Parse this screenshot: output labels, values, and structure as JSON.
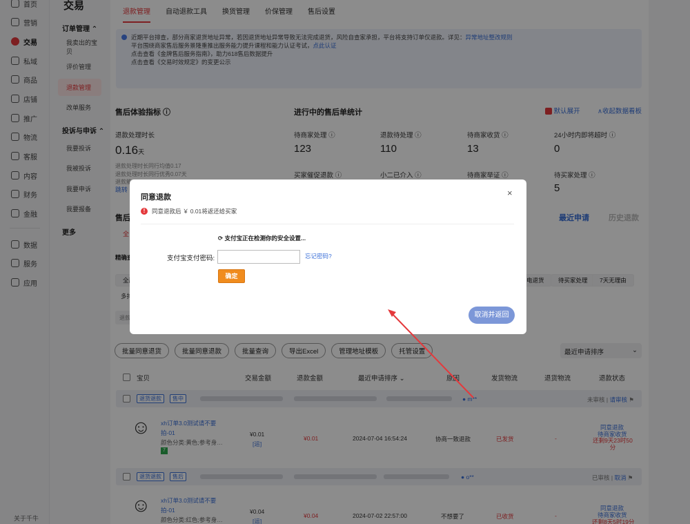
{
  "rail": {
    "items": [
      {
        "label": "首页",
        "icon": "home-icon"
      },
      {
        "label": "营销",
        "icon": "megaphone-icon"
      },
      {
        "label": "交易",
        "icon": "trade-icon",
        "active": true
      },
      {
        "label": "私域",
        "icon": "people-icon"
      },
      {
        "label": "商品",
        "icon": "box-icon"
      },
      {
        "label": "店铺",
        "icon": "store-icon"
      },
      {
        "label": "推广",
        "icon": "promote-icon"
      },
      {
        "label": "物流",
        "icon": "truck-icon"
      },
      {
        "label": "客服",
        "icon": "headset-icon"
      },
      {
        "label": "内容",
        "icon": "content-icon"
      },
      {
        "label": "财务",
        "icon": "finance-icon"
      },
      {
        "label": "金融",
        "icon": "bank-icon"
      },
      {
        "label": "数据",
        "icon": "chart-icon"
      },
      {
        "label": "服务",
        "icon": "grid-icon"
      },
      {
        "label": "应用",
        "icon": "apps-icon"
      }
    ],
    "footer": "关于千牛"
  },
  "side": {
    "title": "交易",
    "groups": [
      {
        "label": "订单管理 ⌃",
        "items": [
          "我卖出的宝贝",
          "评价管理",
          "退款管理",
          "改单服务"
        ]
      },
      {
        "label": "投诉与申诉 ⌃",
        "items": [
          "我要投诉",
          "我被投诉",
          "我要申诉",
          "我要报备"
        ]
      }
    ],
    "more": "更多"
  },
  "tabs": [
    "退款管理",
    "自动退款工具",
    "换货管理",
    "价保管理",
    "售后设置"
  ],
  "notice": {
    "line1": "近期平台排查，部分商家退货地址异常，若因退货地址异常导致无法完成退货，风险自查家承担，平台将支持订单仅退款。详见：",
    "line1_link": "异常地址整改规则",
    "line2": "平台围绕商家售后服务景隆重推出服务能力提升课程和能力认证考试，",
    "line2_link": "点此认证",
    "line3": "点击查看《金牌售后服务指南》，助力618售后数据提升",
    "line4": "点击查看《交易时效规定》的变更公示"
  },
  "metrics": {
    "title": "售后体验指标 ⓘ",
    "refund_label": "退款处理时长",
    "refund_value": "0.16",
    "refund_unit": "天",
    "sub1": "退款处理时长同行均值0.17",
    "sub2": "退款处理时长同行优秀0.07天",
    "sub3": "退款能",
    "jump": "跳转"
  },
  "stats": {
    "title": "进行中的售后单统计",
    "default_expand": "默认展开",
    "collapse": "∧收起数据看板",
    "items": [
      {
        "label": "待商家处理 ⓘ",
        "value": "123"
      },
      {
        "label": "退款待处理 ⓘ",
        "value": "110"
      },
      {
        "label": "待商家收货 ⓘ",
        "value": "13"
      },
      {
        "label": "24小时内即将超时 ⓘ",
        "value": "0"
      },
      {
        "label": "买家催促退款 ⓘ",
        "value": ""
      },
      {
        "label": "小二已介入 ⓘ",
        "value": ""
      },
      {
        "label": "待商家举证 ⓘ",
        "value": ""
      },
      {
        "label": "待买家处理 ⓘ",
        "value": "5"
      }
    ]
  },
  "list": {
    "title_prefix": "售后",
    "recent": "最近申请",
    "history": "历史退款",
    "tab_prefix": "全",
    "filter_prefix": "精确查",
    "chips_right": [
      "电退货",
      "待买家处理",
      "7天无理由"
    ],
    "chip_all": "全部",
    "chip_more": "多排",
    "input_prefix": "退款"
  },
  "actions": [
    "批量同意退货",
    "批量同意退款",
    "批量查询",
    "导出Excel",
    "管理地址模板",
    "托管设置"
  ],
  "sort": "最近申请排序",
  "columns": [
    "宝贝",
    "交易金额",
    "退款金额",
    "最近申请排序 ⌄",
    "原因",
    "发货物流",
    "退货物流",
    "退款状态"
  ],
  "orders": [
    {
      "badge1": "退货退款",
      "badge2": "售中",
      "buyer": "m**",
      "review": "未审核",
      "review_link": "请审核",
      "title": "xh订单3.0测试请不要拍-01",
      "sku": "颜色分类:黄色;参考身…",
      "price": "¥0.01",
      "price_tag": "[运]",
      "refund": "¥0.01",
      "time": "2024-07-04 16:54:24",
      "reason": "协商一致退款",
      "ship": "已发货",
      "return_ship": "-",
      "status1": "同意退款",
      "status2": "待商家收货",
      "status3": "还剩9天23时50分",
      "tag": "7"
    },
    {
      "badge1": "退货退款",
      "badge2": "售后",
      "buyer": "o**",
      "review": "已审核",
      "review_link": "取消",
      "title": "xh订单3.0测试请不要拍-01",
      "sku": "颜色分类:红色;参考身…",
      "price": "¥0.04",
      "price_tag": "[运]",
      "refund": "¥0.04",
      "time": "2024-07-02 22:57:00",
      "reason": "不想要了",
      "ship": "已收货",
      "return_ship": "-",
      "status1": "同意退款",
      "status2": "待商家收货",
      "status3": "还剩8天5时19分"
    }
  ],
  "modal": {
    "title": "同意退款",
    "close": "×",
    "warn": "同意退款后 ￥ 0.01将返还给买家",
    "checking": "支付宝正在检测你的安全设置...",
    "pwd_label": "支付宝支付密码:",
    "forgot": "忘记密码?",
    "ok": "确定",
    "cancel": "取消并返回"
  },
  "colors": {
    "accent": "#e4393c",
    "link": "#3a6fd8",
    "confirm": "#f08c1e",
    "cancel": "#7c97d8"
  }
}
